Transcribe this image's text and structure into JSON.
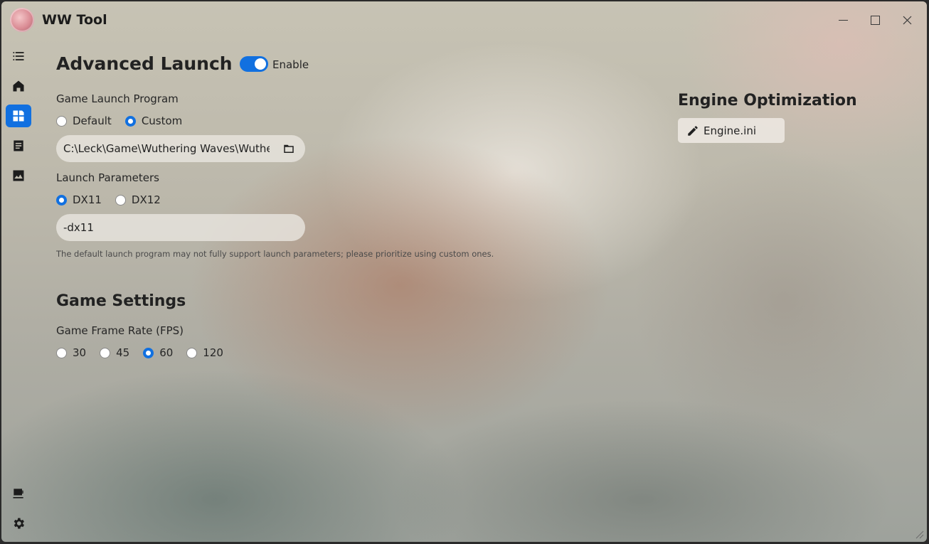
{
  "window": {
    "title": "WW Tool"
  },
  "sidebar": {
    "items": [
      {
        "name": "menu",
        "icon": "menu-icon"
      },
      {
        "name": "home",
        "icon": "home-icon"
      },
      {
        "name": "dashboard",
        "icon": "dashboard-icon",
        "active": true
      },
      {
        "name": "notes",
        "icon": "article-icon"
      },
      {
        "name": "gallery",
        "icon": "image-icon"
      }
    ],
    "bottom_items": [
      {
        "name": "support",
        "icon": "coffee-icon"
      },
      {
        "name": "settings",
        "icon": "gear-icon"
      }
    ]
  },
  "advanced_launch": {
    "title": "Advanced Launch",
    "toggle_label": "Enable",
    "toggle_on": true,
    "program_label": "Game Launch Program",
    "program_options": [
      "Default",
      "Custom"
    ],
    "program_selected": "Custom",
    "program_path": "C:\\Leck\\Game\\Wuthering Waves\\Wuthering Waves Game\\Client\\Binaries\\Win64\\Client-Win64-Shipping.exe",
    "params_label": "Launch Parameters",
    "params_options": [
      "DX11",
      "DX12"
    ],
    "params_selected": "DX11",
    "params_value": "-dx11",
    "hint": "The default launch program may not fully support launch parameters; please prioritize using custom ones."
  },
  "game_settings": {
    "title": "Game Settings",
    "fps_label": "Game Frame Rate (FPS)",
    "fps_options": [
      "30",
      "45",
      "60",
      "120"
    ],
    "fps_selected": "60"
  },
  "engine": {
    "title": "Engine Optimization",
    "button_label": "Engine.ini"
  },
  "colors": {
    "accent": "#1170e0"
  }
}
